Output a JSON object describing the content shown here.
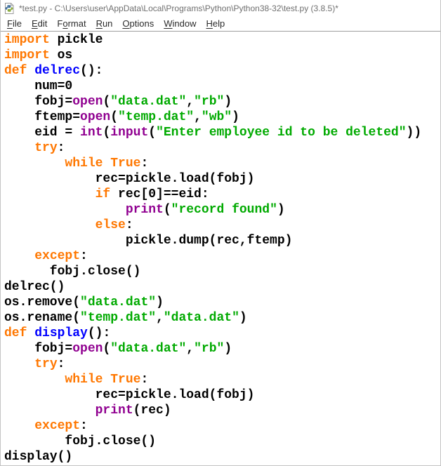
{
  "window": {
    "title": "*test.py - C:\\Users\\user\\AppData\\Local\\Programs\\Python\\Python38-32\\test.py (3.8.5)*"
  },
  "menu": {
    "items": [
      {
        "label": "File",
        "mnemonic": 0
      },
      {
        "label": "Edit",
        "mnemonic": 0
      },
      {
        "label": "Format",
        "mnemonic": 1
      },
      {
        "label": "Run",
        "mnemonic": 0
      },
      {
        "label": "Options",
        "mnemonic": 0
      },
      {
        "label": "Window",
        "mnemonic": 0
      },
      {
        "label": "Help",
        "mnemonic": 0
      }
    ]
  },
  "editor": {
    "colors": {
      "keyword": "#ff7700",
      "builtin": "#900090",
      "string": "#00aa00",
      "definition": "#0000ff",
      "normal": "#000000"
    },
    "lines": [
      [
        {
          "t": "import",
          "c": "kw"
        },
        {
          "t": " pickle",
          "c": "n"
        }
      ],
      [
        {
          "t": "import",
          "c": "kw"
        },
        {
          "t": " os",
          "c": "n"
        }
      ],
      [
        {
          "t": "def",
          "c": "kw"
        },
        {
          "t": " ",
          "c": "n"
        },
        {
          "t": "delrec",
          "c": "def"
        },
        {
          "t": "():",
          "c": "n"
        }
      ],
      [
        {
          "t": "    num=0",
          "c": "n"
        }
      ],
      [
        {
          "t": "    fobj=",
          "c": "n"
        },
        {
          "t": "open",
          "c": "bi"
        },
        {
          "t": "(",
          "c": "n"
        },
        {
          "t": "\"data.dat\"",
          "c": "str"
        },
        {
          "t": ",",
          "c": "n"
        },
        {
          "t": "\"rb\"",
          "c": "str"
        },
        {
          "t": ")",
          "c": "n"
        }
      ],
      [
        {
          "t": "    ftemp=",
          "c": "n"
        },
        {
          "t": "open",
          "c": "bi"
        },
        {
          "t": "(",
          "c": "n"
        },
        {
          "t": "\"temp.dat\"",
          "c": "str"
        },
        {
          "t": ",",
          "c": "n"
        },
        {
          "t": "\"wb\"",
          "c": "str"
        },
        {
          "t": ")",
          "c": "n"
        }
      ],
      [
        {
          "t": "    eid = ",
          "c": "n"
        },
        {
          "t": "int",
          "c": "bi"
        },
        {
          "t": "(",
          "c": "n"
        },
        {
          "t": "input",
          "c": "bi"
        },
        {
          "t": "(",
          "c": "n"
        },
        {
          "t": "\"Enter employee id to be deleted\"",
          "c": "str"
        },
        {
          "t": "))",
          "c": "n"
        }
      ],
      [
        {
          "t": "    ",
          "c": "n"
        },
        {
          "t": "try",
          "c": "kw"
        },
        {
          "t": ":",
          "c": "n"
        }
      ],
      [
        {
          "t": "        ",
          "c": "n"
        },
        {
          "t": "while",
          "c": "kw"
        },
        {
          "t": " ",
          "c": "n"
        },
        {
          "t": "True",
          "c": "kw"
        },
        {
          "t": ":",
          "c": "n"
        }
      ],
      [
        {
          "t": "            rec=pickle.load(fobj)",
          "c": "n"
        }
      ],
      [
        {
          "t": "            ",
          "c": "n"
        },
        {
          "t": "if",
          "c": "kw"
        },
        {
          "t": " rec[0]==eid:",
          "c": "n"
        }
      ],
      [
        {
          "t": "                ",
          "c": "n"
        },
        {
          "t": "print",
          "c": "bi"
        },
        {
          "t": "(",
          "c": "n"
        },
        {
          "t": "\"record found\"",
          "c": "str"
        },
        {
          "t": ")",
          "c": "n"
        }
      ],
      [
        {
          "t": "            ",
          "c": "n"
        },
        {
          "t": "else",
          "c": "kw"
        },
        {
          "t": ":",
          "c": "n"
        }
      ],
      [
        {
          "t": "                pickle.dump(rec,ftemp)",
          "c": "n"
        }
      ],
      [
        {
          "t": "    ",
          "c": "n"
        },
        {
          "t": "except",
          "c": "kw"
        },
        {
          "t": ":",
          "c": "n"
        }
      ],
      [
        {
          "t": "      fobj.close()",
          "c": "n"
        }
      ],
      [
        {
          "t": "delrec()",
          "c": "n"
        }
      ],
      [
        {
          "t": "os.remove(",
          "c": "n"
        },
        {
          "t": "\"data.dat\"",
          "c": "str"
        },
        {
          "t": ")",
          "c": "n"
        }
      ],
      [
        {
          "t": "os.rename(",
          "c": "n"
        },
        {
          "t": "\"temp.dat\"",
          "c": "str"
        },
        {
          "t": ",",
          "c": "n"
        },
        {
          "t": "\"data.dat\"",
          "c": "str"
        },
        {
          "t": ")",
          "c": "n"
        }
      ],
      [
        {
          "t": "def",
          "c": "kw"
        },
        {
          "t": " ",
          "c": "n"
        },
        {
          "t": "display",
          "c": "def"
        },
        {
          "t": "():",
          "c": "n"
        }
      ],
      [
        {
          "t": "    fobj=",
          "c": "n"
        },
        {
          "t": "open",
          "c": "bi"
        },
        {
          "t": "(",
          "c": "n"
        },
        {
          "t": "\"data.dat\"",
          "c": "str"
        },
        {
          "t": ",",
          "c": "n"
        },
        {
          "t": "\"rb\"",
          "c": "str"
        },
        {
          "t": ")",
          "c": "n"
        }
      ],
      [
        {
          "t": "    ",
          "c": "n"
        },
        {
          "t": "try",
          "c": "kw"
        },
        {
          "t": ":",
          "c": "n"
        }
      ],
      [
        {
          "t": "        ",
          "c": "n"
        },
        {
          "t": "while",
          "c": "kw"
        },
        {
          "t": " ",
          "c": "n"
        },
        {
          "t": "True",
          "c": "kw"
        },
        {
          "t": ":",
          "c": "n"
        }
      ],
      [
        {
          "t": "            rec=pickle.load(fobj)",
          "c": "n"
        }
      ],
      [
        {
          "t": "            ",
          "c": "n"
        },
        {
          "t": "print",
          "c": "bi"
        },
        {
          "t": "(rec)",
          "c": "n"
        }
      ],
      [
        {
          "t": "    ",
          "c": "n"
        },
        {
          "t": "except",
          "c": "kw"
        },
        {
          "t": ":",
          "c": "n"
        }
      ],
      [
        {
          "t": "        fobj.close()",
          "c": "n"
        }
      ],
      [
        {
          "t": "display()",
          "c": "n"
        }
      ]
    ]
  }
}
